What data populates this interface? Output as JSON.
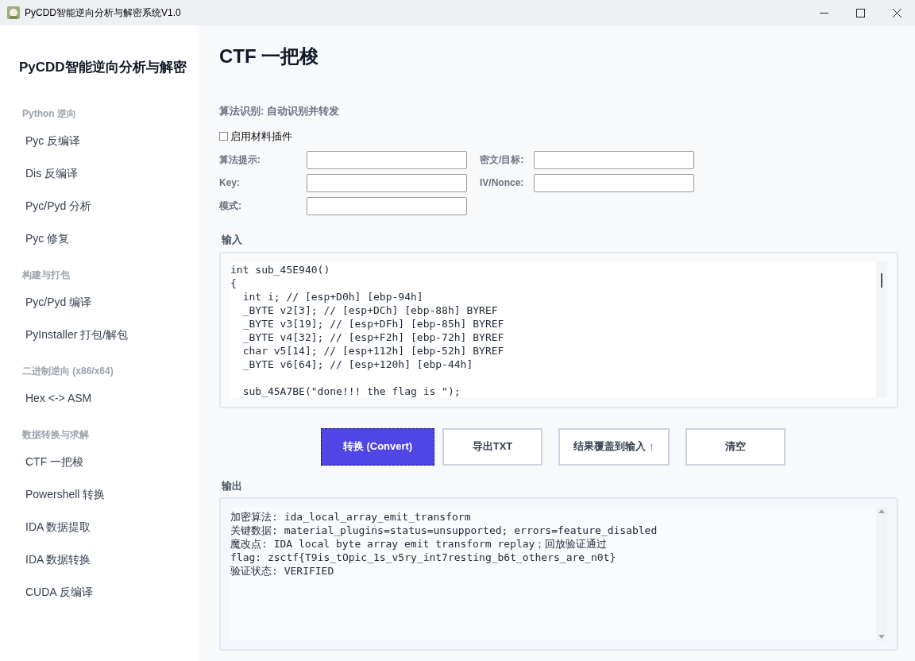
{
  "window": {
    "title": "PyCDD智能逆向分析与解密系统V1.0"
  },
  "sidebar": {
    "title": "PyCDD智能逆向分析与解密",
    "groups": [
      {
        "heading": "Python 逆向",
        "items": [
          {
            "label": "Pyc 反编译",
            "selected": false
          },
          {
            "label": "Dis 反编译",
            "selected": false
          },
          {
            "label": "Pyc/Pyd 分析",
            "selected": false
          },
          {
            "label": "Pyc 修复",
            "selected": false
          }
        ]
      },
      {
        "heading": "构建与打包",
        "items": [
          {
            "label": "Pyc/Pyd 编译",
            "selected": false
          },
          {
            "label": "PyInstaller 打包/解包",
            "selected": false
          }
        ]
      },
      {
        "heading": "二进制逆向 (x86/x64)",
        "items": [
          {
            "label": "Hex <-> ASM",
            "selected": false
          }
        ]
      },
      {
        "heading": "数据转换与求解",
        "items": [
          {
            "label": "CTF 一把梭",
            "selected": false
          },
          {
            "label": "Powershell 转换",
            "selected": false
          },
          {
            "label": "IDA 数据提取",
            "selected": false
          },
          {
            "label": "IDA 数据转换",
            "selected": false
          },
          {
            "label": "CUDA 反编译",
            "selected": false
          }
        ]
      }
    ]
  },
  "page": {
    "title": "CTF 一把梭",
    "algorithm_detection": "算法识别: 自动识别并转发",
    "plugin_checkbox": {
      "label": "启用材料插件",
      "checked": false
    },
    "fields": [
      {
        "label": "算法提示:"
      },
      {
        "label": "密文/目标:"
      },
      {
        "label": "Key:"
      },
      {
        "label": "IV/Nonce:"
      },
      {
        "label": "模式:"
      }
    ],
    "input": {
      "label": "输入",
      "blocks": [
        [
          "int sub_45E940()",
          "{",
          "  int i; // [esp+D0h] [ebp-94h]",
          "  _BYTE v2[3]; // [esp+DCh] [ebp-88h] BYREF",
          "  _BYTE v3[19]; // [esp+DFh] [ebp-85h] BYREF",
          "  _BYTE v4[32]; // [esp+F2h] [ebp-72h] BYREF",
          "  char v5[14]; // [esp+112h] [ebp-52h] BYREF",
          "  _BYTE v6[64]; // [esp+120h] [ebp-44h]"
        ],
        [
          "  sub_45A7BE(\"done!!! the flag is \");"
        ]
      ]
    },
    "buttons": [
      {
        "label": "转换 (Convert)",
        "kind": "primary"
      },
      {
        "label": "导出TXT",
        "kind": "default"
      },
      {
        "label": "结果覆盖到输入 ↑",
        "kind": "default"
      },
      {
        "label": "清空",
        "kind": "default"
      }
    ],
    "output": {
      "label": "输出",
      "blocks": [
        [
          "加密算法: ida_local_array_emit_transform",
          "关键数据: material_plugins=status=unsupported; errors=feature_disabled",
          "魔改点: IDA local byte array emit transform replay；回放验证通过",
          "flag: zsctf{T9is_tOpic_1s_v5ry_int7resting_b6t_others_are_n0t}",
          "验证状态: VERIFIED"
        ]
      ]
    }
  }
}
